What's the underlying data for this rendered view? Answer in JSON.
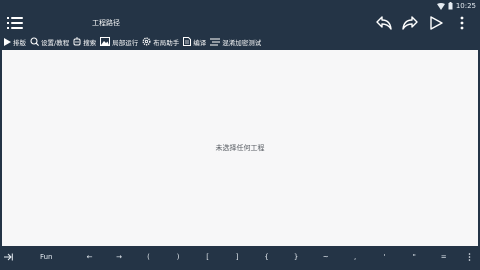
{
  "status": {
    "time": "10:25"
  },
  "header": {
    "title": "工程路径",
    "icons": [
      "menu-icon",
      "undo-icon",
      "redo-icon",
      "play-icon",
      "more-icon"
    ]
  },
  "toolbar": {
    "items": [
      {
        "label": "排版",
        "icon": "play-icon"
      },
      {
        "label": "设置/教程",
        "icon": "search-icon"
      },
      {
        "label": "搜索",
        "icon": "bot-icon"
      },
      {
        "label": "局部运行",
        "icon": "image-icon"
      },
      {
        "label": "布局助手",
        "icon": "gear-icon"
      },
      {
        "label": "编译",
        "icon": "document-icon"
      },
      {
        "label": "混淆加密测试",
        "icon": "lines-icon"
      }
    ]
  },
  "main": {
    "empty_message": "未选择任何工程"
  },
  "keybar": {
    "keys": [
      "Fun",
      "←",
      "→",
      "(",
      ")",
      "[",
      "]",
      "{",
      "}",
      "~",
      ",",
      "'",
      "\"",
      "="
    ]
  },
  "colors": {
    "background": "#243446",
    "content": "#f7f7f8"
  }
}
